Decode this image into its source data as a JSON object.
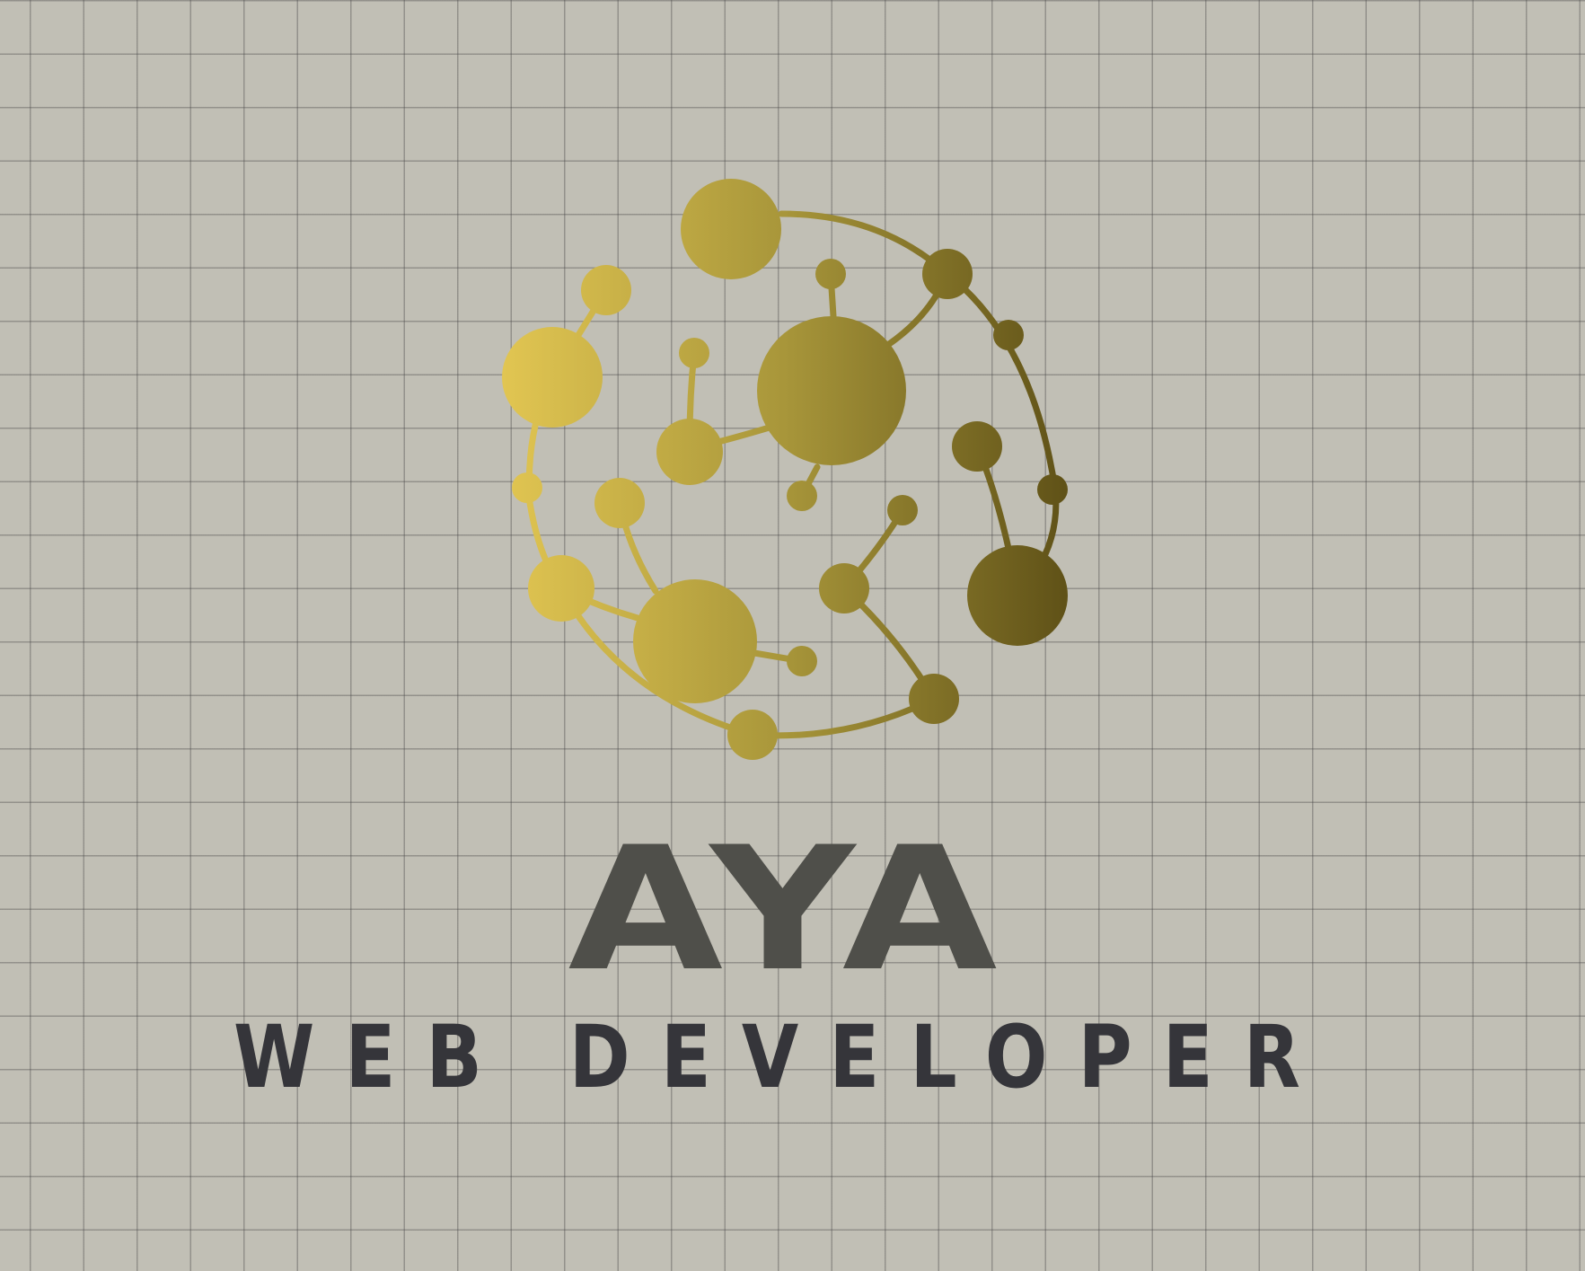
{
  "logo": {
    "brand_name": "AYA",
    "tagline": "WEB DEVELOPER",
    "icon": "molecule-network-globe-icon"
  },
  "colors": {
    "background": "#c1bfb5",
    "grid_lines": "#6e6e6e",
    "gold_light": "#e2c652",
    "gold_mid": "#a8963a",
    "gold_dark": "#5f5117",
    "brand_name_text": "#4f4f4a",
    "tagline_text": "#35353a"
  }
}
